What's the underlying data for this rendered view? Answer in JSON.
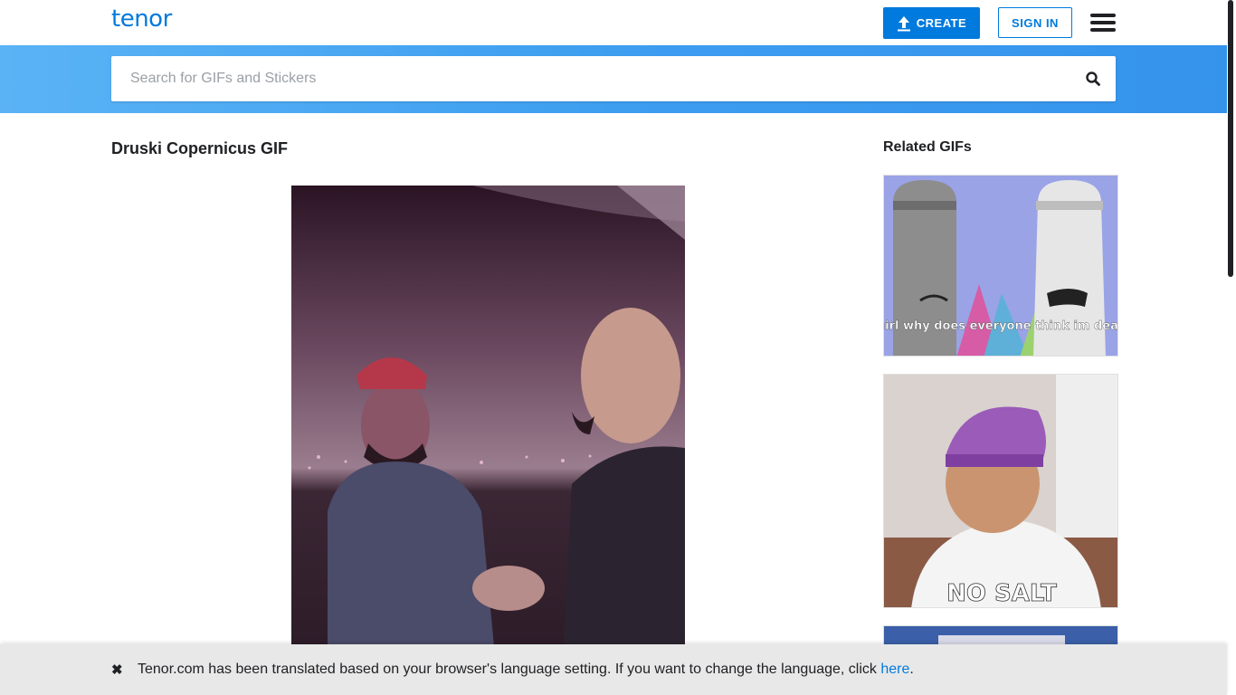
{
  "header": {
    "logo": "tenor",
    "create_label": "CREATE",
    "signin_label": "SIGN IN"
  },
  "search": {
    "placeholder": "Search for GIFs and Stickers",
    "value": ""
  },
  "main": {
    "title": "Druski Copernicus GIF"
  },
  "related": {
    "title": "Related GIFs",
    "items": [
      {
        "caption": "girl why does everyone think im dead"
      },
      {
        "caption": "NO SALT"
      },
      {
        "caption": ""
      }
    ]
  },
  "language_bar": {
    "message_before": "Tenor.com has been translated based on your browser's language setting. If you want to change the language, click ",
    "link_label": "here",
    "message_after": "."
  },
  "colors": {
    "brand_blue": "#007add",
    "search_band": "#3d9ef0"
  }
}
